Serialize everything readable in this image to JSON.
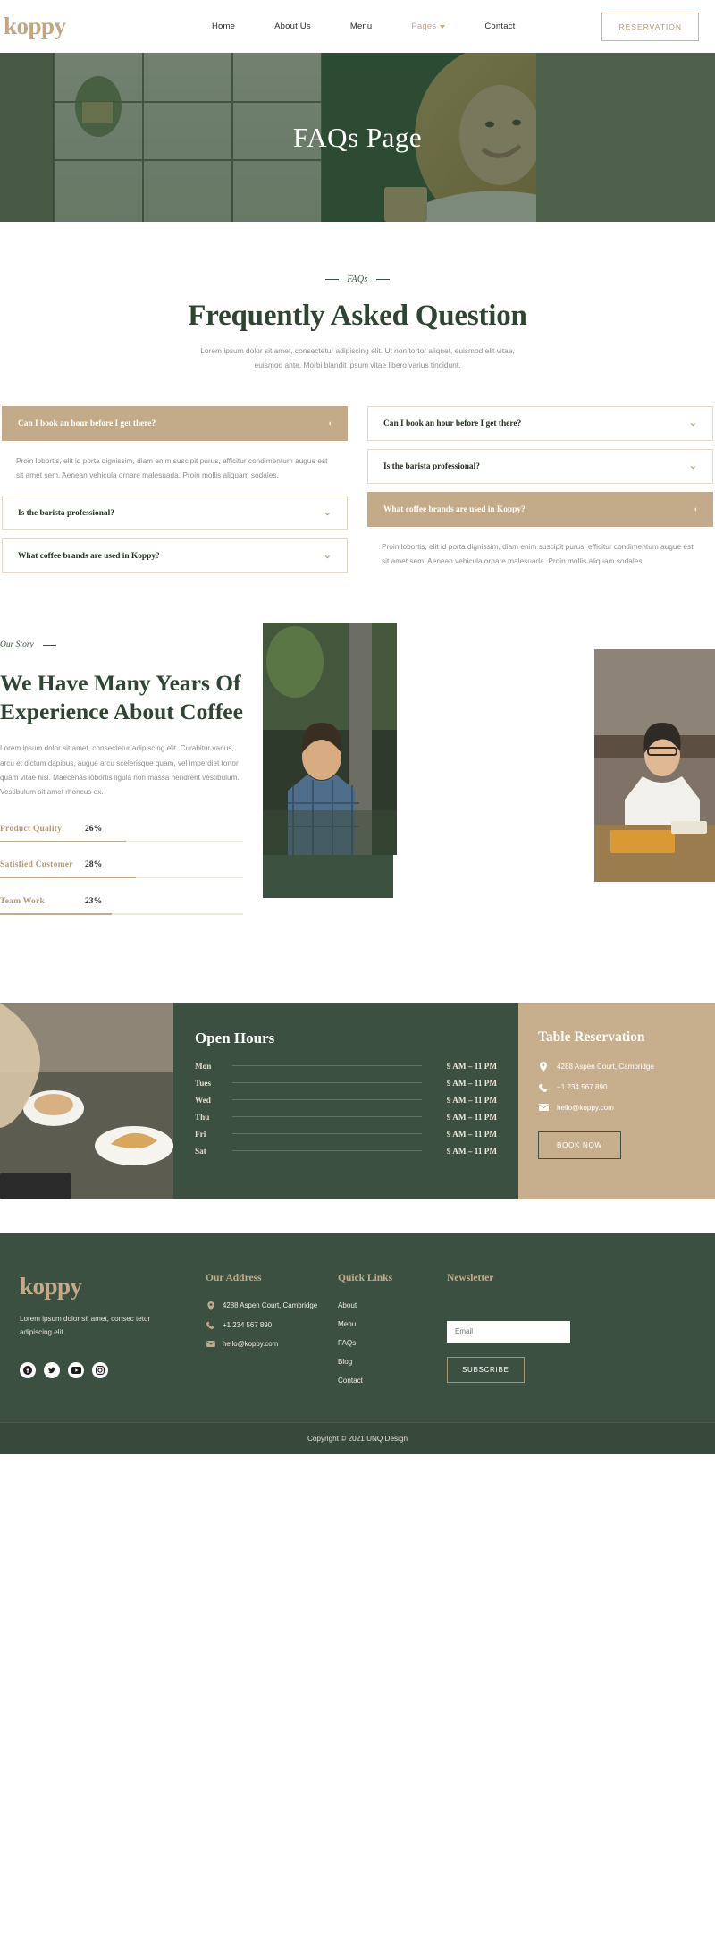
{
  "brand": {
    "logo": "koppy"
  },
  "header": {
    "nav": [
      {
        "label": "Home",
        "active": false
      },
      {
        "label": "About Us",
        "active": false
      },
      {
        "label": "Menu",
        "active": false
      },
      {
        "label": "Pages",
        "active": true,
        "has_caret": true
      },
      {
        "label": "Contact",
        "active": false
      }
    ],
    "cta": "RESERVATION",
    "accent_color": "#c0a782"
  },
  "hero": {
    "title": "FAQs Page"
  },
  "faq": {
    "eyebrow": "FAQs",
    "title": "Frequently Asked Question",
    "subtitle": "Lorem ipsum dolor sit amet, consectetur adipiscing elit. Ut non tortor aliquet, euismod elit vitae, euismod ante. Morbi blandit ipsum vitae libero varius tincidunt.",
    "answer": "Proin lobortis, elit id porta dignissim, diam enim suscipit purus, efficitur condimentum augue est sit amet sem. Aenean vehicula ornare malesuada. Proin mollis aliquam sodales.",
    "left_column": [
      {
        "question": "Can I book an hour before I get there?",
        "open": true
      },
      {
        "question": "Is the barista professional?",
        "open": false
      },
      {
        "question": "What coffee brands are used in Koppy?",
        "open": false
      }
    ],
    "right_column": [
      {
        "question": "Can I book an hour before I get there?",
        "open": false
      },
      {
        "question": "Is the barista professional?",
        "open": false
      },
      {
        "question": "What coffee brands are used in Koppy?",
        "open": true
      }
    ]
  },
  "story": {
    "eyebrow": "Our Story",
    "title": "We Have Many Years Of Experience About Coffee",
    "text": "Lorem ipsum dolor sit amet, consectetur adipiscing elit. Curabitur varius, arcu et dictum dapibus, augue arcu scelerisque quam, vel imperdiet tortor quam vitae nisl. Maecenas lobortis ligula non massa hendrerit vestibulum. Vestibulum sit amet rhoncus ex.",
    "stats": [
      {
        "label": "Product Quality",
        "value": "26%",
        "pct": 26
      },
      {
        "label": "Satisfied Customer",
        "value": "28%",
        "pct": 28
      },
      {
        "label": "Team Work",
        "value": "23%",
        "pct": 23
      }
    ]
  },
  "hours": {
    "title": "Open Hours",
    "rows": [
      {
        "day": "Mon",
        "time": "9 AM – 11 PM"
      },
      {
        "day": "Tues",
        "time": "9 AM – 11 PM"
      },
      {
        "day": "Wed",
        "time": "9 AM – 11 PM"
      },
      {
        "day": "Thu",
        "time": "9 AM – 11 PM"
      },
      {
        "day": "Fri",
        "time": "9 AM – 11 PM"
      },
      {
        "day": "Sat",
        "time": "9 AM – 11 PM"
      }
    ]
  },
  "reservation": {
    "title": "Table Reservation",
    "address": "4288 Aspen Court, Cambridge",
    "phone": "+1 234 567 890",
    "email": "hello@koppy.com",
    "button": "BOOK NOW"
  },
  "footer": {
    "logo": "koppy",
    "description": "Lorem ipsum dolor sit amet, consec tetur adipiscing elit.",
    "socials": [
      "facebook-icon",
      "twitter-icon",
      "youtube-icon",
      "instagram-icon"
    ],
    "address_title": "Our Address",
    "address": "4288 Aspen Court, Cambridge",
    "phone": "+1 234 567 890",
    "email": "hello@koppy.com",
    "links_title": "Quick Links",
    "links": [
      "About",
      "Menu",
      "FAQs",
      "Blog",
      "Contact"
    ],
    "newsletter_title": "Newsletter",
    "email_placeholder": "Email",
    "email_value": "",
    "subscribe": "SUBSCRIBE",
    "copyright": "Copyright © 2021 UNQ Design"
  },
  "colors": {
    "green": "#3b5040",
    "tan": "#c3ab8a",
    "dark_green_text": "#2f4432"
  }
}
